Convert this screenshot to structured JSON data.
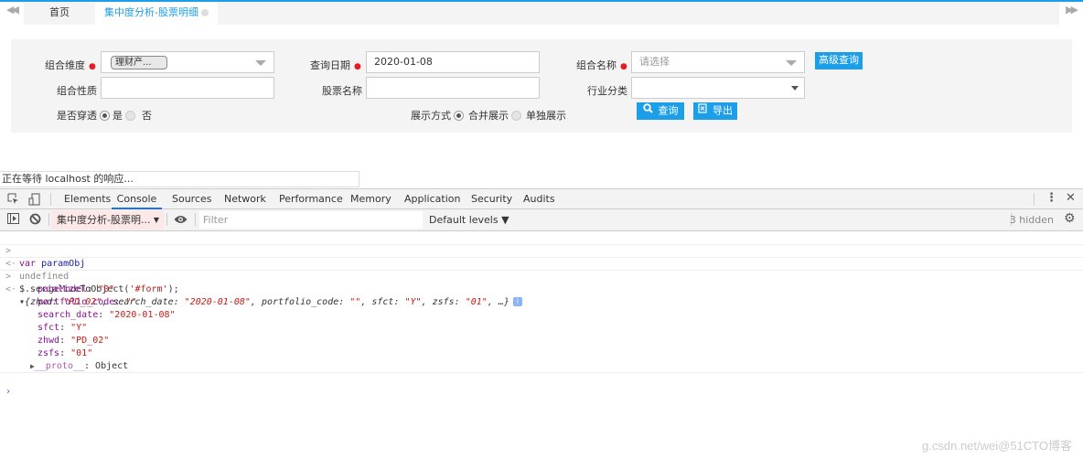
{
  "tabs": {
    "home": "首页",
    "active": "集中度分析-股票明细"
  },
  "form": {
    "zhwd_label": "组合维度",
    "zhwd_chip": "理财产...",
    "search_date_label": "查询日期",
    "search_date_value": "2020-01-08",
    "portfolio_name_label": "组合名称",
    "portfolio_name_placeholder": "请选择",
    "advanced_button": "高级查询",
    "portfolio_nature_label": "组合性质",
    "stock_name_label": "股票名称",
    "industry_label": "行业分类",
    "penetrate_label": "是否穿透",
    "penetrate_yes": "是",
    "penetrate_no": "否",
    "display_label": "展示方式",
    "display_merge": "合并展示",
    "display_single": "单独展示",
    "query_button": "查询",
    "export_button": "导出"
  },
  "status": "正在等待 localhost 的响应...",
  "devtools": {
    "tabs": [
      "Elements",
      "Console",
      "Sources",
      "Network",
      "Performance",
      "Memory",
      "Application",
      "Security",
      "Audits"
    ],
    "active_tab": "Console",
    "context": "集中度分析-股票明...",
    "filter_placeholder": "Filter",
    "levels": "Default levels ▼",
    "hidden": "3 hidden"
  },
  "console": {
    "l1_kw": "var",
    "l1_ident": " paramObj",
    "l2": "undefined",
    "l3_a": "$.serializeToObject(",
    "l3_str": "'#form'",
    "l3_b": ");",
    "summary": {
      "k1": "zhwd: ",
      "v1": "\"PD_02\"",
      "k2": ", search_date: ",
      "v2": "\"2020-01-08\"",
      "k3": ", portfolio_code: ",
      "v3": "\"\"",
      "k4": ", sfct: ",
      "v4": "\"Y\"",
      "k5": ", zsfs: ",
      "v5": "\"01\"",
      "tail": ", …}"
    },
    "props": [
      {
        "key": "pageModel",
        "value": "\"0\""
      },
      {
        "key": "portfolio_code",
        "value": "\"\""
      },
      {
        "key": "search_date",
        "value": "\"2020-01-08\""
      },
      {
        "key": "sfct",
        "value": "\"Y\""
      },
      {
        "key": "zhwd",
        "value": "\"PD_02\""
      },
      {
        "key": "zsfs",
        "value": "\"01\""
      }
    ],
    "proto_key": "__proto__",
    "proto_value": ": Object"
  },
  "watermark": "g.csdn.net/wei@51CTO博客"
}
